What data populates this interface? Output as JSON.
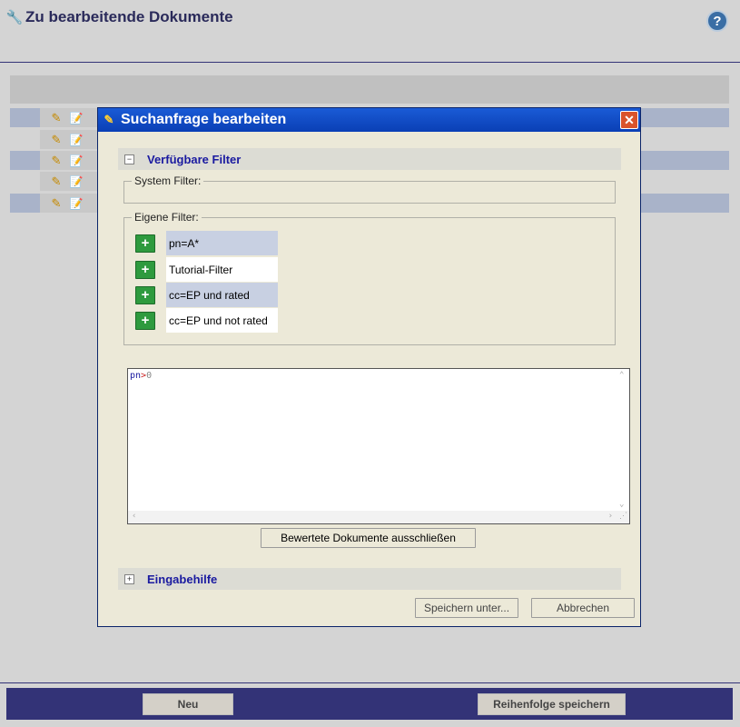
{
  "header": {
    "title": "Zu bearbeitende Dokumente",
    "help_label": "?"
  },
  "dialog": {
    "title": "Suchanfrage bearbeiten",
    "close_label": "✕",
    "available_filters": {
      "label": "Verfügbare Filter",
      "toggle": "−"
    },
    "system_filter": {
      "legend": "System Filter:"
    },
    "own_filters": {
      "legend": "Eigene Filter:",
      "items": [
        {
          "label": "pn=A*"
        },
        {
          "label": "Tutorial-Filter"
        },
        {
          "label": "cc=EP und rated"
        },
        {
          "label": "cc=EP und not rated"
        }
      ]
    },
    "query": {
      "field": "pn",
      "operator": ">",
      "value": "0"
    },
    "exclude_button": "Bewertete Dokumente ausschließen",
    "input_help": {
      "label": "Eingabehilfe",
      "toggle": "+"
    },
    "save_as_button": "Speichern unter...",
    "cancel_button": "Abbrechen"
  },
  "footer": {
    "new_button": "Neu",
    "save_order_button": "Reihenfolge speichern"
  },
  "colors": {
    "accent": "#333377",
    "titlebar": "#0a3fb5",
    "row_alt": "#a9b3c9"
  }
}
